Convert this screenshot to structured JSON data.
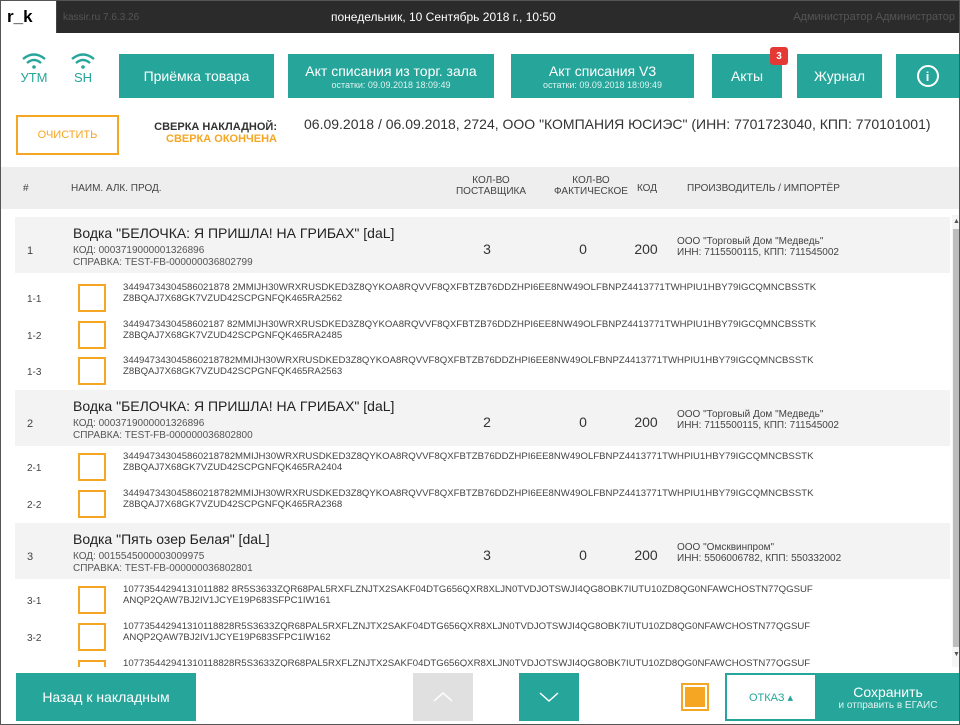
{
  "titlebar": {
    "logo": "r_k",
    "version": "kassir.ru 7.6.3.26",
    "datetime": "понедельник, 10 Сентябрь 2018 г., 10:50",
    "user": "Администратор Администратор"
  },
  "nav": {
    "utm": "УТМ",
    "sh": "SH",
    "receive": "Приёмка товара",
    "act_hall": "Акт списания из торг. зала",
    "act_hall_sub": "остатки: 09.09.2018 18:09:49",
    "act_v3": "Акт списания V3",
    "act_v3_sub": "остатки: 09.09.2018 18:09:49",
    "acts": "Акты",
    "acts_badge": "3",
    "journal": "Журнал",
    "info": "i"
  },
  "toolbar": {
    "clear": "ОЧИСТИТЬ",
    "check_label": "СВЕРКА НАКЛАДНОЙ:",
    "check_status": "СВЕРКА ОКОНЧЕНА",
    "doc": "06.09.2018 / 06.09.2018, 2724, ООО \"КОМПАНИЯ ЮСИЭС\" (ИНН: 7701723040, КПП: 770101001)"
  },
  "columns": {
    "num": "#",
    "name": "НАИМ. АЛК. ПРОД.",
    "qty_sup": "КОЛ-ВО\nПОСТАВЩИКА",
    "qty_fact": "КОЛ-ВО\nФАКТИЧЕСКОЕ",
    "code": "КОД",
    "maker": "ПРОИЗВОДИТЕЛЬ / ИМПОРТЁР"
  },
  "rows": [
    {
      "num": "1",
      "name": "Водка \"БЕЛОЧКА: Я ПРИШЛА! НА ГРИБАХ\"  [daL]",
      "code_line": "КОД: 0003719000001326896",
      "ref": "СПРАВКА: TEST-FB-000000036802799",
      "qty_sup": "3",
      "qty_fact": "0",
      "code": "200",
      "maker": "ООО \"Торговый Дом \"Медведь\"",
      "maker_inn": "ИНН: 7115500115, КПП: 711545002"
    },
    {
      "num": "2",
      "name": "Водка \"БЕЛОЧКА: Я ПРИШЛА! НА ГРИБАХ\"  [daL]",
      "code_line": "КОД: 0003719000001326896",
      "ref": "СПРАВКА: TEST-FB-000000036802800",
      "qty_sup": "2",
      "qty_fact": "0",
      "code": "200",
      "maker": "ООО \"Торговый Дом \"Медведь\"",
      "maker_inn": "ИНН: 7115500115, КПП: 711545002"
    },
    {
      "num": "3",
      "name": "Водка \"Пять озер Белая\"  [daL]",
      "code_line": "КОД: 0015545000003009975",
      "ref": "СПРАВКА: TEST-FB-000000036802801",
      "qty_sup": "3",
      "qty_fact": "0",
      "code": "200",
      "maker": "ООО \"Омсквинпром\"",
      "maker_inn": "ИНН: 5506006782, КПП: 550332002"
    }
  ],
  "subs": [
    {
      "num": "1-1",
      "l1": "34494734304586021878 2MMIJH30WRXRUSDKED3Z8QYKOA8RQVVF8QXFBTZB76DDZHPI6EE8NW49OLFBNPZ4413771TWHPIU1HBY79IGCQMNCBSSTK",
      "l2": "Z8BQAJ7X68GK7VZUD42SCPGNFQK465RA2562"
    },
    {
      "num": "1-2",
      "l1": "3449473430458602187 82MMIJH30WRXRUSDKED3Z8QYKOA8RQVVF8QXFBTZB76DDZHPI6EE8NW49OLFBNPZ4413771TWHPIU1HBY79IGCQMNCBSSTK",
      "l2": "Z8BQAJ7X68GK7VZUD42SCPGNFQK465RA2485"
    },
    {
      "num": "1-3",
      "l1": "344947343045860218782MMIJH30WRXRUSDKED3Z8QYKOA8RQVVF8QXFBTZB76DDZHPI6EE8NW49OLFBNPZ4413771TWHPIU1HBY79IGCQMNCBSSTK",
      "l2": "Z8BQAJ7X68GK7VZUD42SCPGNFQK465RA2563"
    },
    {
      "num": "2-1",
      "l1": "344947343045860218782MMIJH30WRXRUSDKED3Z8QYKOA8RQVVF8QXFBTZB76DDZHPI6EE8NW49OLFBNPZ4413771TWHPIU1HBY79IGCQMNCBSSTK",
      "l2": "Z8BQAJ7X68GK7VZUD42SCPGNFQK465RA2404"
    },
    {
      "num": "2-2",
      "l1": "344947343045860218782MMIJH30WRXRUSDKED3Z8QYKOA8RQVVF8QXFBTZB76DDZHPI6EE8NW49OLFBNPZ4413771TWHPIU1HBY79IGCQMNCBSSTK",
      "l2": "Z8BQAJ7X68GK7VZUD42SCPGNFQK465RA2368"
    },
    {
      "num": "3-1",
      "l1": "10773544294131011882 8R5S3633ZQR68PAL5RXFLZNJTX2SAKF04DTG656QXR8XLJN0TVDJOTSWJI4QG8OBK7IUTU10ZD8QG0NFAWCHOSTN77QGSUF",
      "l2": "ANQP2QAW7BJ2IV1JCYE19P683SFPC1IW161"
    },
    {
      "num": "3-2",
      "l1": "107735442941310118828R5S3633ZQR68PAL5RXFLZNJTX2SAKF04DTG656QXR8XLJN0TVDJOTSWJI4QG8OBK7IUTU10ZD8QG0NFAWCHOSTN77QGSUF",
      "l2": "ANQP2QAW7BJ2IV1JCYE19P683SFPC1IW162"
    },
    {
      "num": "3-3",
      "l1": "107735442941310118828R5S3633ZQR68PAL5RXFLZNJTX2SAKF04DTG656QXR8XLJN0TVDJOTSWJI4QG8OBK7IUTU10ZD8QG0NFAWCHOSTN77QGSUF",
      "l2": ""
    }
  ],
  "footer": {
    "back": "Назад к накладным",
    "refuse": "ОТКАЗ ▴",
    "save": "Сохранить",
    "save_sub": "и отправить в ЕГАИС"
  },
  "colors": {
    "accent": "#26a69a",
    "orange": "#f5a623",
    "badge": "#e53935"
  }
}
